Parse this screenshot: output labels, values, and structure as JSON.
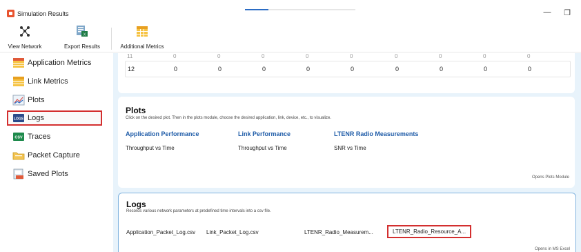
{
  "window": {
    "title": "Simulation Results",
    "minimize_glyph": "—",
    "restore_glyph": "❐",
    "progress_fraction": 0.21
  },
  "toolbar": {
    "view_network": "View Network",
    "export_results": "Export Results",
    "additional_metrics": "Additional Metrics"
  },
  "sidebar": {
    "items": [
      {
        "label": "Application Metrics",
        "icon": "table-icon"
      },
      {
        "label": "Link Metrics",
        "icon": "table-icon"
      },
      {
        "label": "Plots",
        "icon": "chart-icon"
      },
      {
        "label": "Logs",
        "icon": "logs-icon"
      },
      {
        "label": "Traces",
        "icon": "csv-icon"
      },
      {
        "label": "Packet Capture",
        "icon": "folder-icon"
      },
      {
        "label": "Saved Plots",
        "icon": "saved-plots-icon"
      }
    ],
    "selected_index": 3
  },
  "metrics_table": {
    "ghost_row": [
      "11",
      "0",
      "0",
      "0",
      "0",
      "0",
      "0",
      "0",
      "0",
      "0"
    ],
    "row": [
      "12",
      "0",
      "0",
      "0",
      "0",
      "0",
      "0",
      "0",
      "0",
      "0"
    ]
  },
  "plots": {
    "title": "Plots",
    "description": "Click on the desired plot. Then in the plots module, choose the desired application, link, device, etc., to visualize.",
    "columns": [
      {
        "heading": "Application Performance",
        "link": "Throughput vs Time"
      },
      {
        "heading": "Link Performance",
        "link": "Throughput vs Time"
      },
      {
        "heading": "LTENR Radio Measurements",
        "link": "SNR vs Time"
      }
    ],
    "footnote": "Opens Plots Module"
  },
  "logs": {
    "title": "Logs",
    "description": "Records various network parameters at predefined time intervals into a csv file.",
    "files": [
      "Application_Packet_Log.csv",
      "Link_Packet_Log.csv",
      "LTENR_Radio_Measurem...",
      "LTENR_Radio_Resource_A..."
    ],
    "highlighted_index": 3,
    "footnote": "Opens in MS Excel"
  },
  "colors": {
    "accent_blue": "#1f5ca8",
    "highlight_red": "#d32f2f",
    "panel_bg": "#e8f3fb"
  }
}
